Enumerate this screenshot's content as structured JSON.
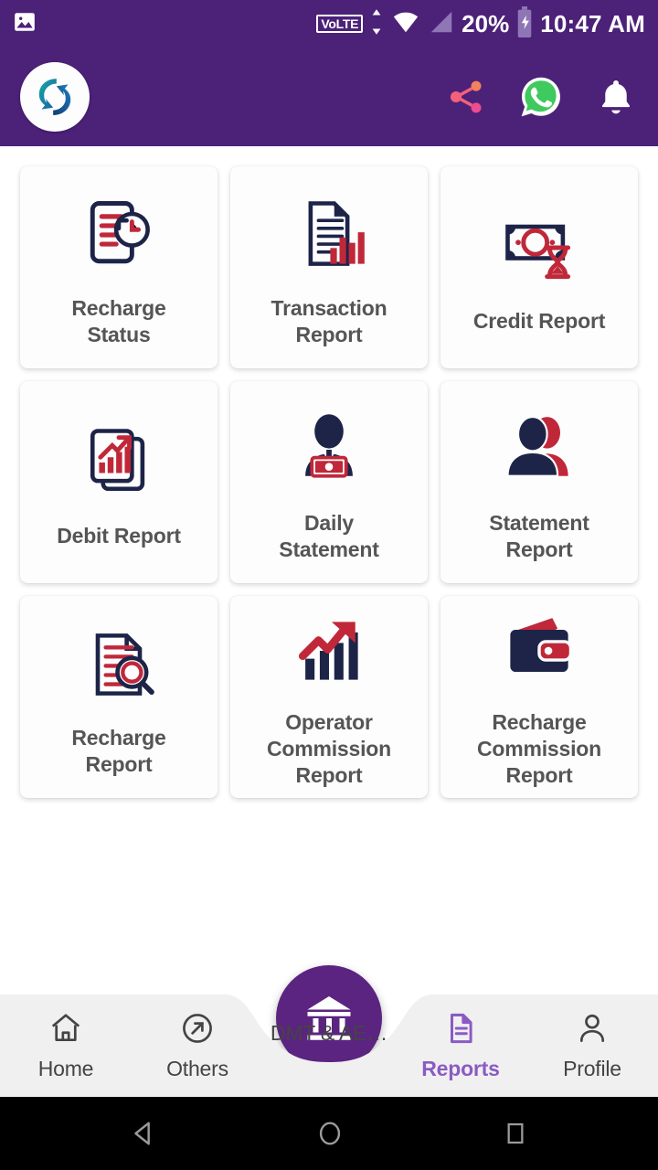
{
  "status_bar": {
    "gallery_icon": "image-icon",
    "volte_label": "VoLTE",
    "data_arrows_icon": "data-transfer-icon",
    "wifi_icon": "wifi-icon",
    "signal_icon": "cellular-signal-icon",
    "battery_percent": "20%",
    "battery_icon": "battery-charging-icon",
    "time": "10:47 AM"
  },
  "app_bar": {
    "logo_icon": "app-logo-icon",
    "share_icon": "share-icon",
    "whatsapp_icon": "whatsapp-icon",
    "notification_icon": "bell-icon",
    "background_color": "#4C2178"
  },
  "grid": {
    "cards": [
      {
        "label": "Recharge\nStatus",
        "icon": "recharge-status-icon"
      },
      {
        "label": "Transaction\nReport",
        "icon": "transaction-report-icon"
      },
      {
        "label": "Credit Report",
        "icon": "credit-report-icon"
      },
      {
        "label": "Debit Report",
        "icon": "debit-report-icon"
      },
      {
        "label": "Daily\nStatement",
        "icon": "daily-statement-icon"
      },
      {
        "label": "Statement\nReport",
        "icon": "statement-report-icon"
      },
      {
        "label": "Recharge\nReport",
        "icon": "recharge-report-icon"
      },
      {
        "label": "Operator\nCommission\nReport",
        "icon": "operator-commission-icon"
      },
      {
        "label": "Recharge\nCommission\nReport",
        "icon": "recharge-commission-icon"
      }
    ],
    "icon_navy": "#1D2448",
    "icon_red": "#C0283A",
    "label_color": "#555555"
  },
  "bottom_nav": {
    "items": [
      {
        "label": "Home",
        "icon": "home-icon",
        "active": false
      },
      {
        "label": "Others",
        "icon": "arrow-circle-icon",
        "active": false
      },
      {
        "label": "DMT & AE…",
        "icon": "bank-icon",
        "active": false
      },
      {
        "label": "Reports",
        "icon": "document-icon",
        "active": true
      },
      {
        "label": "Profile",
        "icon": "person-icon",
        "active": false
      }
    ],
    "fab_color": "#5B2481",
    "active_color": "#8A5BC4",
    "inactive_color": "#444444"
  },
  "android_nav": {
    "back_icon": "back-triangle-icon",
    "home_icon": "home-circle-icon",
    "recents_icon": "recents-square-icon"
  }
}
